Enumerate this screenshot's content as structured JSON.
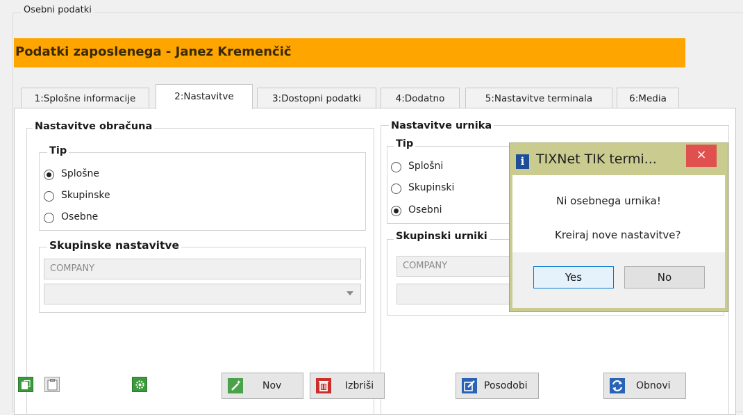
{
  "outer_group": {
    "label": "Osebni podatki"
  },
  "header": {
    "title": "Podatki zaposlenega - Janez Kremenčič",
    "color": "#ffa500"
  },
  "tabs": [
    {
      "label": "1:Splošne informacije",
      "active": false
    },
    {
      "label": "2:Nastavitve",
      "active": true
    },
    {
      "label": "3:Dostopni podatki",
      "active": false
    },
    {
      "label": "4:Dodatno",
      "active": false
    },
    {
      "label": "5:Nastavitve terminala",
      "active": false
    },
    {
      "label": "6:Media",
      "active": false
    }
  ],
  "billing": {
    "title": "Nastavitve obračuna",
    "type_group": {
      "title": "Tip",
      "options": [
        {
          "label": "Splošne",
          "checked": true
        },
        {
          "label": "Skupinske",
          "checked": false
        },
        {
          "label": "Osebne",
          "checked": false
        }
      ]
    },
    "group_settings": {
      "title": "Skupinske nastavitve",
      "field_value": "COMPANY",
      "select_value": ""
    }
  },
  "schedule": {
    "title": "Nastavitve urnika",
    "type_group": {
      "title": "Tip",
      "options": [
        {
          "label": "Splošni",
          "checked": false
        },
        {
          "label": "Skupinski",
          "checked": false
        },
        {
          "label": "Osebni",
          "checked": true
        }
      ]
    },
    "group_schedules": {
      "title": "Skupinski urniki",
      "field_value": "COMPANY"
    }
  },
  "toolbar": {
    "copy_icon": "copy-icon",
    "paste_icon": "clipboard-icon",
    "settings_icon": "gear-icon",
    "new_label": "Nov",
    "delete_label": "Izbriši",
    "update_label": "Posodobi",
    "refresh_label": "Obnovi"
  },
  "dialog": {
    "title": "TIXNet TIK termi...",
    "icon": "info-icon",
    "message_line1": "Ni osebnega urnika!",
    "message_line2": "Kreiraj nove nastavitve?",
    "yes_label": "Yes",
    "no_label": "No",
    "close_symbol": "×"
  }
}
